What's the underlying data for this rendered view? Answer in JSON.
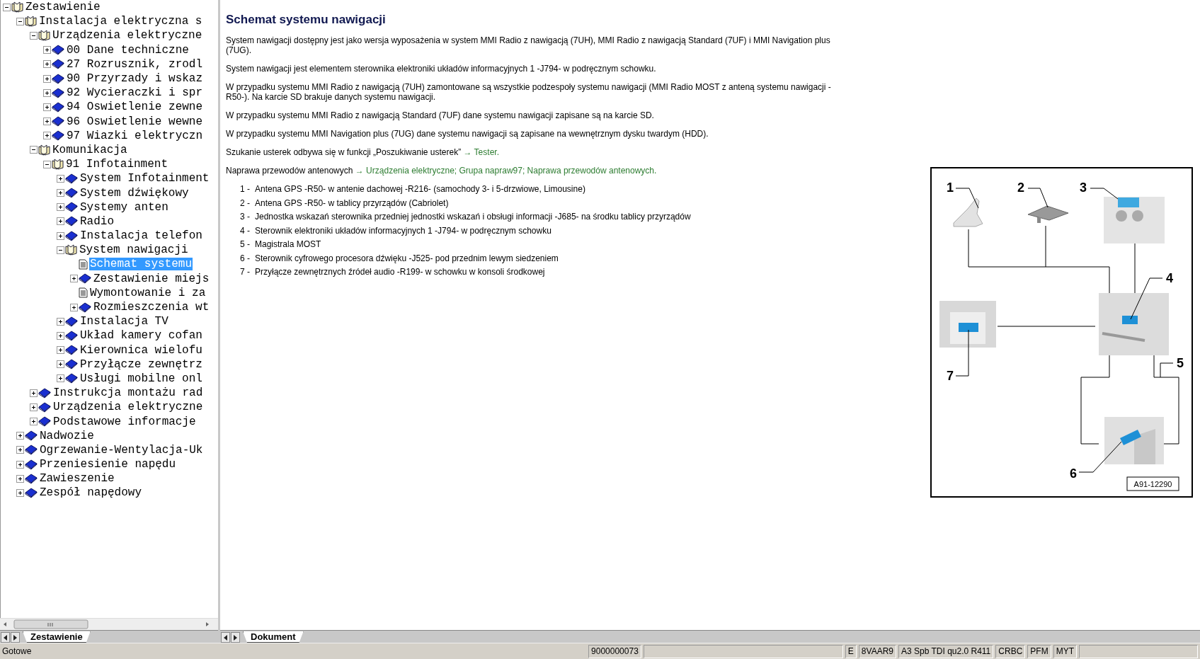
{
  "tree": [
    {
      "label": "Zestawienie",
      "kind": "book",
      "expanded": true,
      "selected": false,
      "children": [
        {
          "label": "Instalacja elektryczna s",
          "kind": "book",
          "expanded": true,
          "selected": false,
          "children": [
            {
              "label": "Urządzenia elektryczne",
              "kind": "book",
              "expanded": true,
              "selected": false,
              "children": [
                {
                  "label": "00 Dane techniczne",
                  "kind": "book",
                  "expanded": false,
                  "selected": false
                },
                {
                  "label": "27 Rozrusznik, zrodl",
                  "kind": "book",
                  "expanded": false,
                  "selected": false
                },
                {
                  "label": "90 Przyrzady i wskaz",
                  "kind": "book",
                  "expanded": false,
                  "selected": false
                },
                {
                  "label": "92 Wycieraczki i spr",
                  "kind": "book",
                  "expanded": false,
                  "selected": false
                },
                {
                  "label": "94 Oswietlenie zewne",
                  "kind": "book",
                  "expanded": false,
                  "selected": false
                },
                {
                  "label": "96 Oswietlenie wewne",
                  "kind": "book",
                  "expanded": false,
                  "selected": false
                },
                {
                  "label": "97 Wiazki elektryczn",
                  "kind": "book",
                  "expanded": false,
                  "selected": false
                }
              ]
            },
            {
              "label": "Komunikacja",
              "kind": "book",
              "expanded": true,
              "selected": false,
              "children": [
                {
                  "label": "91 Infotainment",
                  "kind": "book",
                  "expanded": true,
                  "selected": false,
                  "children": [
                    {
                      "label": "System Infotainment",
                      "kind": "book",
                      "expanded": false,
                      "selected": false
                    },
                    {
                      "label": "System dźwiękowy",
                      "kind": "book",
                      "expanded": false,
                      "selected": false
                    },
                    {
                      "label": "Systemy anten",
                      "kind": "book",
                      "expanded": false,
                      "selected": false
                    },
                    {
                      "label": "Radio",
                      "kind": "book",
                      "expanded": false,
                      "selected": false
                    },
                    {
                      "label": "Instalacja telefon",
                      "kind": "book",
                      "expanded": false,
                      "selected": false
                    },
                    {
                      "label": "System nawigacji",
                      "kind": "book",
                      "expanded": true,
                      "selected": false,
                      "children": [
                        {
                          "label": "Schemat systemu",
                          "kind": "doc",
                          "selected": true
                        },
                        {
                          "label": "Zestawienie miejs",
                          "kind": "book",
                          "expanded": false,
                          "selected": false
                        },
                        {
                          "label": "Wymontowanie i za",
                          "kind": "doc",
                          "selected": false
                        },
                        {
                          "label": "Rozmieszczenia wt",
                          "kind": "book",
                          "expanded": false,
                          "selected": false
                        }
                      ]
                    },
                    {
                      "label": "Instalacja TV",
                      "kind": "book",
                      "expanded": false,
                      "selected": false
                    },
                    {
                      "label": "Układ kamery cofan",
                      "kind": "book",
                      "expanded": false,
                      "selected": false
                    },
                    {
                      "label": "Kierownica wielofu",
                      "kind": "book",
                      "expanded": false,
                      "selected": false
                    },
                    {
                      "label": "Przyłącze zewnętrz",
                      "kind": "book",
                      "expanded": false,
                      "selected": false
                    },
                    {
                      "label": "Usługi mobilne onl",
                      "kind": "book",
                      "expanded": false,
                      "selected": false
                    }
                  ]
                }
              ]
            },
            {
              "label": "Instrukcja montażu rad",
              "kind": "book",
              "expanded": false,
              "selected": false
            },
            {
              "label": "Urządzenia elektryczne",
              "kind": "book",
              "expanded": false,
              "selected": false
            },
            {
              "label": "Podstawowe informacje",
              "kind": "book",
              "expanded": false,
              "selected": false
            }
          ]
        },
        {
          "label": "Nadwozie",
          "kind": "book",
          "expanded": false,
          "selected": false
        },
        {
          "label": "Ogrzewanie-Wentylacja-Uk",
          "kind": "book",
          "expanded": false,
          "selected": false
        },
        {
          "label": "Przeniesienie napędu",
          "kind": "book",
          "expanded": false,
          "selected": false
        },
        {
          "label": "Zawieszenie",
          "kind": "book",
          "expanded": false,
          "selected": false
        },
        {
          "label": "Zespół napędowy",
          "kind": "book",
          "expanded": false,
          "selected": false
        }
      ]
    }
  ],
  "left_tabs": [
    {
      "label": "Zestawienie",
      "selected": true
    }
  ],
  "right_tabs": [
    {
      "label": "Dokument",
      "selected": true
    }
  ],
  "document": {
    "title": "Schemat systemu nawigacji",
    "paragraphs": [
      {
        "text": "System nawigacji dostępny jest jako wersja wyposażenia w system MMI Radio z nawigacją (7UH), MMI Radio z nawigacją Standard (7UF) i MMI Navigation plus (7UG)."
      },
      {
        "text": "System nawigacji jest elementem sterownika elektroniki układów informacyjnych 1 -J794- w podręcznym schowku."
      },
      {
        "text": "W przypadku systemu MMI Radio z nawigacją (7UH) zamontowane są wszystkie podzespoły systemu nawigacji (MMI Radio MOST z anteną systemu nawigacji -R50-). Na karcie SD brakuje danych systemu nawigacji."
      },
      {
        "text": "W przypadku systemu MMI Radio z nawigacją Standard (7UF) dane systemu nawigacji zapisane są na karcie SD."
      },
      {
        "text": "W przypadku systemu MMI Navigation plus (7UG) dane systemu nawigacji są zapisane na wewnętrznym dysku twardym (HDD)."
      },
      {
        "text": "Szukanie usterek odbywa się w funkcji „Poszukiwanie usterek”",
        "link": "→ Tester."
      },
      {
        "text": "Naprawa przewodów antenowych",
        "link": "→ Urządzenia elektryczne; Grupa napraw97; Naprawa przewodów antenowych."
      }
    ],
    "legend": [
      {
        "number": "1 -",
        "text": "Antena GPS -R50- w antenie dachowej -R216- (samochody 3- i 5-drzwiowe, Limousine)"
      },
      {
        "number": "2 -",
        "text": "Antena GPS -R50- w tablicy przyrządów (Cabriolet)"
      },
      {
        "number": "3 -",
        "text": "Jednostka wskazań sterownika przedniej jednostki wskazań i obsługi informacji -J685- na środku tablicy przyrządów"
      },
      {
        "number": "4 -",
        "text": "Sterownik elektroniki układów informacyjnych 1 -J794- w podręcznym schowku"
      },
      {
        "number": "5 -",
        "text": "Magistrala MOST"
      },
      {
        "number": "6 -",
        "text": "Sterownik cyfrowego procesora dźwięku -J525- pod przednim lewym siedzeniem"
      },
      {
        "number": "7 -",
        "text": "Przyłącze zewnętrznych źródeł audio -R199- w schowku w konsoli środkowej"
      }
    ],
    "figure": {
      "callouts": [
        "1",
        "2",
        "3",
        "4",
        "5",
        "6",
        "7"
      ],
      "figure_id": "A91-12290"
    }
  },
  "status_bar": {
    "message": "Gotowe",
    "fields": [
      "9000000073",
      "E",
      "8VAAR9",
      "A3 Spb TDI qu2.0 R411",
      "CRBC",
      "PFM",
      "MYT"
    ]
  }
}
